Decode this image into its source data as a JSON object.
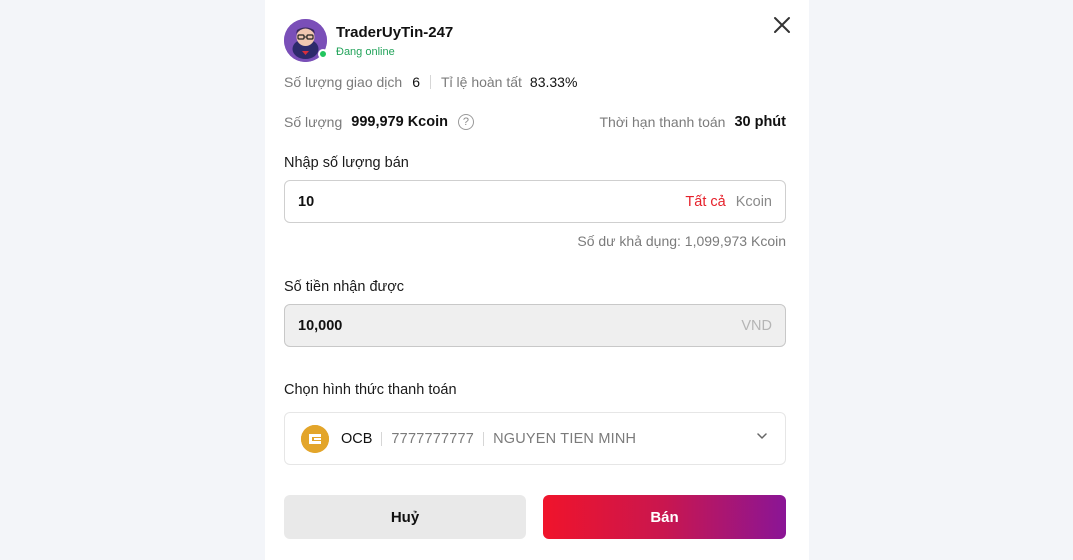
{
  "seller": {
    "name": "TraderUyTin-247",
    "status": "Đang online"
  },
  "stats": {
    "trades_label": "Số lượng giao dịch",
    "trades_value": "6",
    "completion_label": "Tỉ lệ hoàn tất",
    "completion_value": "83.33%"
  },
  "quantity": {
    "label": "Số lượng",
    "value": "999,979 Kcoin",
    "deadline_label": "Thời hạn thanh toán",
    "deadline_value": "30 phút"
  },
  "sell_input": {
    "label": "Nhập số lượng bán",
    "value": "10",
    "all_label": "Tất cả",
    "unit": "Kcoin",
    "balance_text": "Số dư khả dụng: 1,099,973 Kcoin"
  },
  "receive": {
    "label": "Số tiền nhận được",
    "value": "10,000",
    "unit": "VND"
  },
  "payment": {
    "label": "Chọn hình thức thanh toán",
    "bank": "OCB",
    "account_number": "7777777777",
    "account_name": "NGUYEN TIEN MINH"
  },
  "actions": {
    "cancel_label": "Huỷ",
    "sell_label": "Bán"
  },
  "colors": {
    "accent_red": "#e6212b",
    "online_green": "#22c55e",
    "sell_gradient_start": "#f0142b",
    "sell_gradient_end": "#8a1596",
    "bank_logo": "#e3a52a"
  },
  "icons": {
    "close": "close-icon",
    "help": "question-circle-icon",
    "chevron": "chevron-down-icon",
    "bank": "ocb-bank-logo-icon"
  }
}
